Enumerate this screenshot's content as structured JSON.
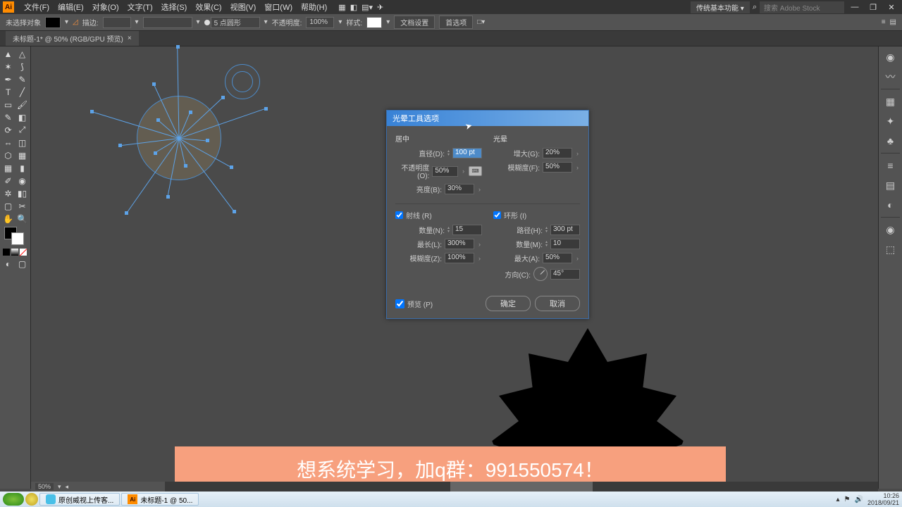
{
  "menubar": {
    "items": [
      "文件(F)",
      "编辑(E)",
      "对象(O)",
      "文字(T)",
      "选择(S)",
      "效果(C)",
      "视图(V)",
      "窗口(W)",
      "帮助(H)"
    ],
    "workspace": "传统基本功能",
    "search_placeholder": "搜索 Adobe Stock"
  },
  "optionsbar": {
    "noselection": "未选择对象",
    "stroke_label": "描边:",
    "level_label": "5 点圆形",
    "opacity_label": "不透明度:",
    "opacity_value": "100%",
    "style_label": "样式:",
    "docsetup": "文档设置",
    "prefs": "首选项"
  },
  "tab": {
    "title": "未标题-1* @ 50% (RGB/GPU 预览)"
  },
  "dialog": {
    "title": "光晕工具选项",
    "center_label": "居中",
    "halo_label": "光晕",
    "diameter_label": "直径(D):",
    "diameter_value": "100 pt",
    "center_opacity_label": "不透明度(O):",
    "center_opacity_value": "50%",
    "brightness_label": "亮度(B):",
    "brightness_value": "30%",
    "growth_label": "增大(G):",
    "growth_value": "20%",
    "halo_fuzz_label": "模糊度(F):",
    "halo_fuzz_value": "50%",
    "rays_label": "射线 (R)",
    "rings_label": "环形 (I)",
    "ray_count_label": "数量(N):",
    "ray_count_value": "15",
    "ray_longest_label": "最长(L):",
    "ray_longest_value": "300%",
    "ray_fuzz_label": "模糊度(Z):",
    "ray_fuzz_value": "100%",
    "ring_path_label": "路径(H):",
    "ring_path_value": "300 pt",
    "ring_count_label": "数量(M):",
    "ring_count_value": "10",
    "ring_largest_label": "最大(A):",
    "ring_largest_value": "50%",
    "direction_label": "方向(C):",
    "direction_value": "45°",
    "preview_label": "预览 (P)",
    "ok": "确定",
    "cancel": "取消"
  },
  "banner": {
    "text": "想系统学习，加q群：991550574！"
  },
  "status": {
    "zoom": "50%"
  },
  "taskbar": {
    "task1": "原创威视上传客...",
    "task2": "未标题-1 @ 50...",
    "time": "10:26",
    "date": "2018/09/21"
  }
}
